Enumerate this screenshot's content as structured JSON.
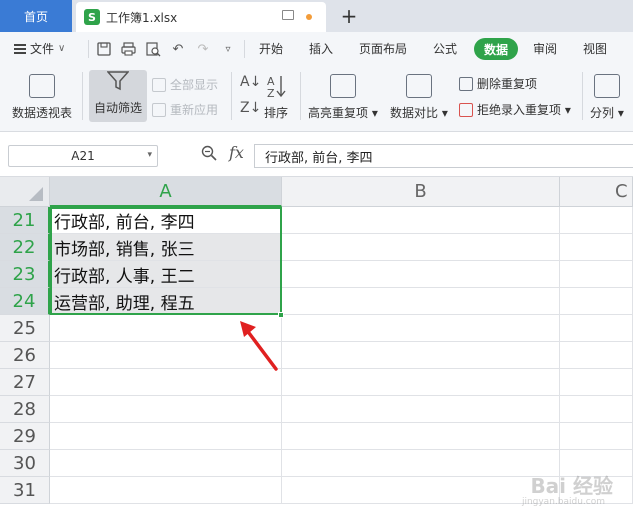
{
  "titlebar": {
    "home_tab": "首页",
    "doc_tab": "工作簿1.xlsx",
    "doc_icon_letter": "S",
    "add_tab": "+"
  },
  "menubar": {
    "file": "文件",
    "items": [
      "开始",
      "插入",
      "页面布局",
      "公式",
      "数据",
      "审阅",
      "视图"
    ],
    "active": "数据"
  },
  "ribbon": {
    "pivot": "数据透视表",
    "auto_filter": "自动筛选",
    "show_all": "全部显示",
    "reapply": "重新应用",
    "sort": "排序",
    "highlight_dup": "高亮重复项",
    "compare": "数据对比",
    "remove_dup": "删除重复项",
    "reject_dup": "拒绝录入重复项",
    "split": "分列"
  },
  "formula_bar": {
    "cell_ref": "A21",
    "fx": "fx",
    "content": "行政部, 前台, 李四"
  },
  "grid": {
    "columns": [
      "A",
      "B",
      "C"
    ],
    "rows": [
      {
        "num": "21",
        "a": "行政部, 前台, 李四"
      },
      {
        "num": "22",
        "a": "市场部, 销售, 张三"
      },
      {
        "num": "23",
        "a": "行政部, 人事, 王二"
      },
      {
        "num": "24",
        "a": "运营部, 助理, 程五"
      },
      {
        "num": "25",
        "a": ""
      },
      {
        "num": "26",
        "a": ""
      },
      {
        "num": "27",
        "a": ""
      },
      {
        "num": "28",
        "a": ""
      },
      {
        "num": "29",
        "a": ""
      },
      {
        "num": "30",
        "a": ""
      },
      {
        "num": "31",
        "a": ""
      }
    ],
    "selected_column": "A",
    "selected_rows": [
      "21",
      "22",
      "23",
      "24"
    ]
  },
  "watermark": {
    "main": "Bai 经验",
    "sub": "jingyan.baidu.com"
  },
  "colors": {
    "accent_green": "#2fa34a",
    "home_blue": "#3a7bd5",
    "arrow_red": "#e02020"
  }
}
